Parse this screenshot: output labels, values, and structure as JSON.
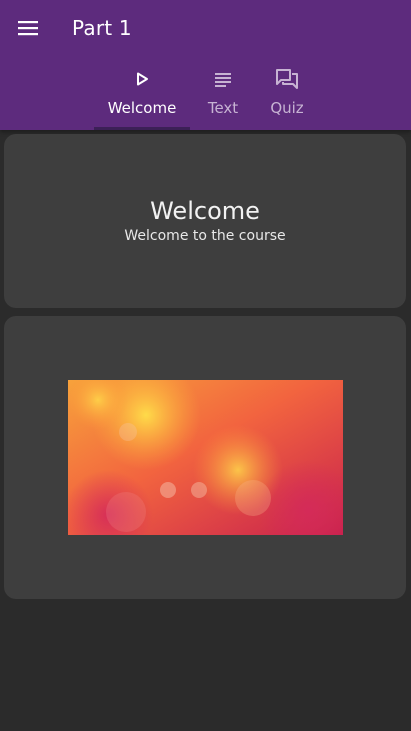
{
  "app": {
    "title": "Part 1"
  },
  "tabs": [
    {
      "label": "Welcome",
      "icon": "play-icon",
      "active": true
    },
    {
      "label": "Text",
      "icon": "text-lines-icon",
      "active": false
    },
    {
      "label": "Quiz",
      "icon": "chat-bubbles-icon",
      "active": false
    }
  ],
  "welcome_card": {
    "heading": "Welcome",
    "subtitle": "Welcome to the course"
  },
  "image_card": {
    "image": "abstract-bokeh-orange-red-image"
  },
  "colors": {
    "appbar": "#5d2b7d",
    "background": "#2b2b2b",
    "card": "#3e3e3e",
    "tab_active": "#ffffff",
    "tab_inactive": "#c7b3d3"
  }
}
